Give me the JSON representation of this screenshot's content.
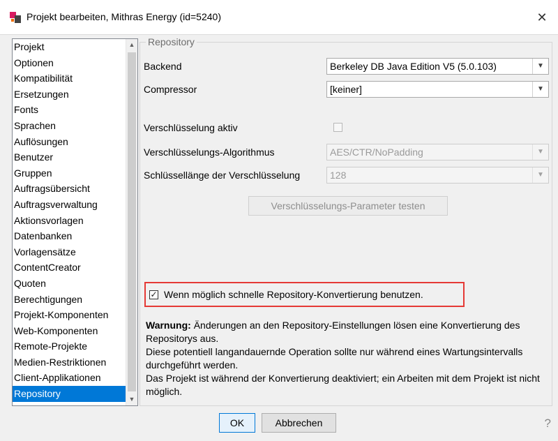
{
  "window": {
    "title": "Projekt bearbeiten, Mithras Energy (id=5240)",
    "close_glyph": "✕",
    "icon": "app-icon"
  },
  "nav": {
    "items": [
      {
        "label": "Projekt"
      },
      {
        "label": "Optionen"
      },
      {
        "label": "Kompatibilität"
      },
      {
        "label": "Ersetzungen"
      },
      {
        "label": "Fonts"
      },
      {
        "label": "Sprachen"
      },
      {
        "label": "Auflösungen"
      },
      {
        "label": "Benutzer"
      },
      {
        "label": "Gruppen"
      },
      {
        "label": "Auftragsübersicht"
      },
      {
        "label": "Auftragsverwaltung"
      },
      {
        "label": "Aktionsvorlagen"
      },
      {
        "label": "Datenbanken"
      },
      {
        "label": "Vorlagensätze"
      },
      {
        "label": "ContentCreator"
      },
      {
        "label": "Quoten"
      },
      {
        "label": "Berechtigungen"
      },
      {
        "label": "Projekt-Komponenten"
      },
      {
        "label": "Web-Komponenten"
      },
      {
        "label": "Remote-Projekte"
      },
      {
        "label": "Medien-Restriktionen"
      },
      {
        "label": "Client-Applikationen"
      },
      {
        "label": "Repository"
      }
    ],
    "selected": "Repository"
  },
  "repository": {
    "legend": "Repository",
    "backend_label": "Backend",
    "backend_value": "Berkeley DB Java Edition V5 (5.0.103)",
    "compressor_label": "Compressor",
    "compressor_value": "[keiner]",
    "encryption_active_label": "Verschlüsselung aktiv",
    "algorithm_label": "Verschlüsselungs-Algorithmus",
    "algorithm_value": "AES/CTR/NoPadding",
    "keylength_label": "Schlüssellänge der Verschlüsselung",
    "keylength_value": "128",
    "test_button_label": "Verschlüsselungs-Parameter testen",
    "fast_conversion_label": "Wenn möglich schnelle Repository-Konvertierung benutzen.",
    "warning_bold": "Warnung:",
    "warning_line1": " Änderungen an den Repository-Einstellungen lösen eine Konvertierung des Repositorys aus.",
    "warning_line2": "Diese potentiell langandauernde Operation sollte nur während eines Wartungsintervalls durchgeführt werden.",
    "warning_line3": "Das Projekt ist während der Konvertierung deaktiviert; ein Arbeiten mit dem Projekt ist nicht möglich."
  },
  "footer": {
    "ok_label": "OK",
    "cancel_label": "Abbrechen",
    "help_glyph": "?"
  },
  "colors": {
    "selection": "#0078d7",
    "highlight": "#e53935"
  }
}
